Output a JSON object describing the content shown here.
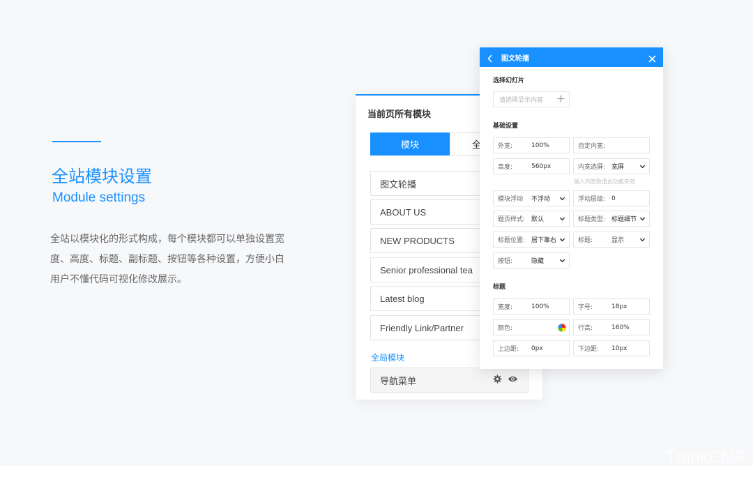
{
  "intro": {
    "title": "全站模块设置",
    "subtitle": "Module settings",
    "description": "全站以模块化的形式构成，每个模块都可以单独设置宽度、高度、标题、副标题、按钮等各种设置，方便小白用户不懂代码可视化修改展示。"
  },
  "panel": {
    "title": "当前页所有模块",
    "tab_active": "模块",
    "tab_other": "全",
    "modules": [
      "图文轮播",
      "ABOUT US",
      "NEW PRODUCTS",
      "Senior professional tea",
      "Latest blog",
      "Friendly Link/Partner"
    ],
    "global_label": "全局模块",
    "nav_item": "导航菜单",
    "nav_icons": [
      "gear-icon",
      "eye-icon"
    ]
  },
  "popup": {
    "title": "图文轮播",
    "section_slides": "选择幻灯片",
    "slides_placeholder": "请选择显示内容",
    "section_basic": "基础设置",
    "section_title": "标题",
    "outer_width_label": "外宽:",
    "outer_width_value": "100%",
    "custom_inner_label": "自定内宽:",
    "height_label": "高度:",
    "height_value": "560px",
    "inner_select_label": "内宽选屏:",
    "inner_select_value": "宽屏",
    "hint": "输入内宽数值此功能失效",
    "float_label": "模块浮动",
    "float_value": "不浮动",
    "float_level_label": "浮动层级:",
    "float_level_value": "0",
    "header_style_label": "题页样式:",
    "header_style_value": "默认",
    "title_type_label": "标题类型:",
    "title_type_value": "标题细节",
    "title_pos_label": "标题位置:",
    "title_pos_value": "居下靠右",
    "title_show_label": "标题:",
    "title_show_value": "显示",
    "button_label": "按钮:",
    "button_value": "隐藏",
    "t_width_label": "宽度:",
    "t_width_value": "100%",
    "font_size_label": "字号:",
    "font_size_value": "18px",
    "color_label": "颜色:",
    "line_height_label": "行高:",
    "line_height_value": "160%",
    "margin_top_label": "上边距:",
    "margin_top_value": "0px",
    "margin_bottom_label": "下边距:",
    "margin_bottom_value": "10px",
    "accent_color": "#1890ff"
  },
  "watermark": "ThinkCMF"
}
